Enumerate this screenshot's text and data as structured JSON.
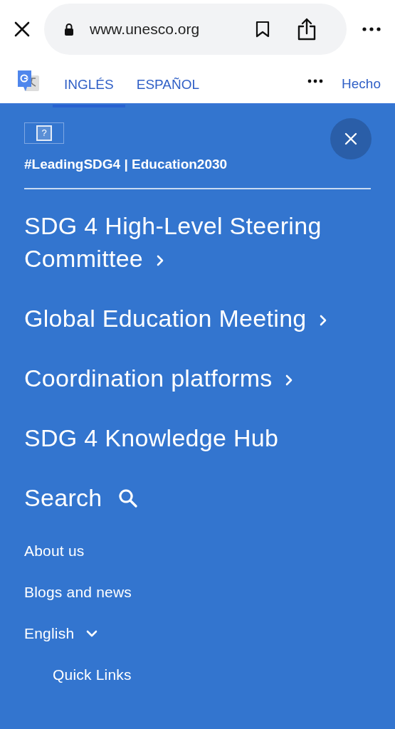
{
  "browser": {
    "url": "www.unesco.org"
  },
  "translate_bar": {
    "tabs": [
      {
        "label": "INGLÉS",
        "selected": true
      },
      {
        "label": "ESPAÑOL",
        "selected": false
      }
    ],
    "done": "Hecho"
  },
  "menu": {
    "broken_image": "?",
    "tagline": "#LeadingSDG4 | Education2030",
    "main_items": [
      {
        "label": "SDG 4 High-Level Steering Committee",
        "kind": "submenu"
      },
      {
        "label": "Global Education Meeting",
        "kind": "submenu"
      },
      {
        "label": "Coordination platforms",
        "kind": "submenu"
      },
      {
        "label": "SDG 4 Knowledge Hub",
        "kind": "link"
      },
      {
        "label": "Search",
        "kind": "search"
      }
    ],
    "small_items": [
      {
        "label": "About us",
        "kind": "link"
      },
      {
        "label": "Blogs and news",
        "kind": "link"
      },
      {
        "label": "English",
        "kind": "dropdown"
      },
      {
        "label": "Quick Links",
        "kind": "sublink"
      }
    ]
  }
}
